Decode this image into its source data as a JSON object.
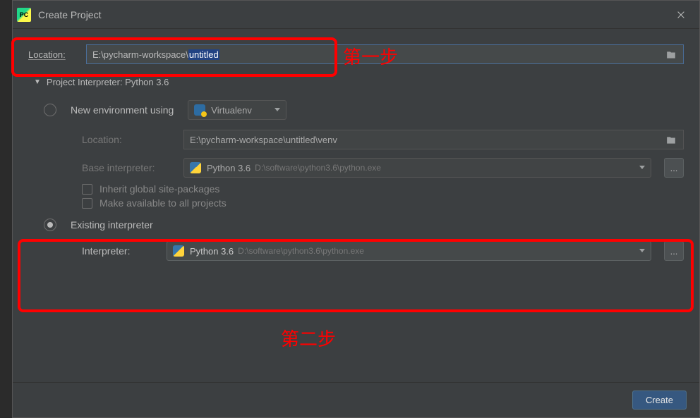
{
  "window": {
    "title": "Create Project",
    "app_icon_text": "PC"
  },
  "location": {
    "label": "Location:",
    "value_prefix": "E:\\pycharm-workspace\\",
    "value_selected": "untitled"
  },
  "interpreter_disclose": "Project Interpreter: Python 3.6",
  "new_env": {
    "label": "New environment using",
    "combo": "Virtualenv",
    "loc_label": "Location:",
    "loc_value": "E:\\pycharm-workspace\\untitled\\venv",
    "base_label": "Base interpreter:",
    "base_name": "Python 3.6",
    "base_path": "D:\\software\\python3.6\\python.exe",
    "inherit": "Inherit global site-packages",
    "make_avail": "Make available to all projects"
  },
  "existing": {
    "label": "Existing interpreter",
    "interp_label": "Interpreter:",
    "interp_name": "Python 3.6",
    "interp_path": "D:\\software\\python3.6\\python.exe"
  },
  "footer": {
    "create": "Create"
  },
  "annotations": {
    "step1": "第一步",
    "step2": "第二步"
  },
  "glyphs": {
    "ellipsis": "...",
    "triangle": "▼"
  }
}
